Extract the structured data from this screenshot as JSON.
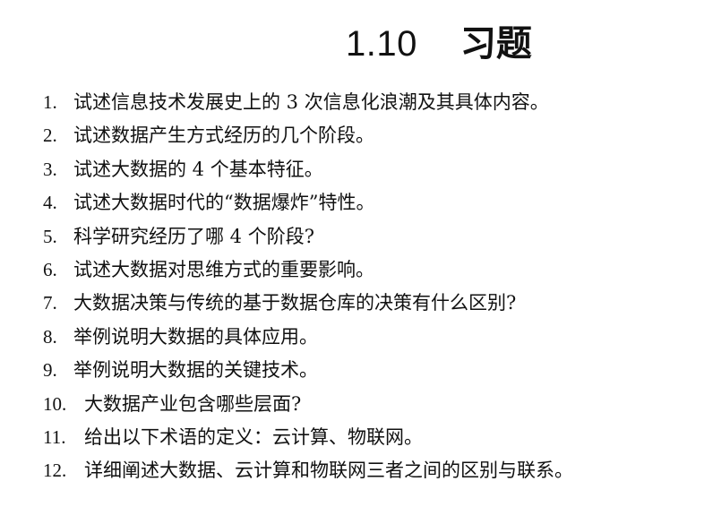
{
  "section": {
    "number": "1.10",
    "title": "习题"
  },
  "exercises": [
    {
      "number": "1.",
      "text": "试述信息技术发展史上的 3 次信息化浪潮及其具体内容。"
    },
    {
      "number": "2.",
      "text": "试述数据产生方式经历的几个阶段。"
    },
    {
      "number": "3.",
      "text": "试述大数据的 4 个基本特征。"
    },
    {
      "number": "4.",
      "text": "试述大数据时代的“数据爆炸”特性。"
    },
    {
      "number": "5.",
      "text": "科学研究经历了哪 4 个阶段?"
    },
    {
      "number": "6.",
      "text": "试述大数据对思维方式的重要影响。"
    },
    {
      "number": "7.",
      "text": "大数据决策与传统的基于数据仓库的决策有什么区别?"
    },
    {
      "number": "8.",
      "text": "举例说明大数据的具体应用。"
    },
    {
      "number": "9.",
      "text": "举例说明大数据的关键技术。"
    },
    {
      "number": "10.",
      "text": "大数据产业包含哪些层面?"
    },
    {
      "number": "11.",
      "text": "给出以下术语的定义：云计算、物联网。"
    },
    {
      "number": "12.",
      "text": "详细阐述大数据、云计算和物联网三者之间的区别与联系。"
    }
  ]
}
